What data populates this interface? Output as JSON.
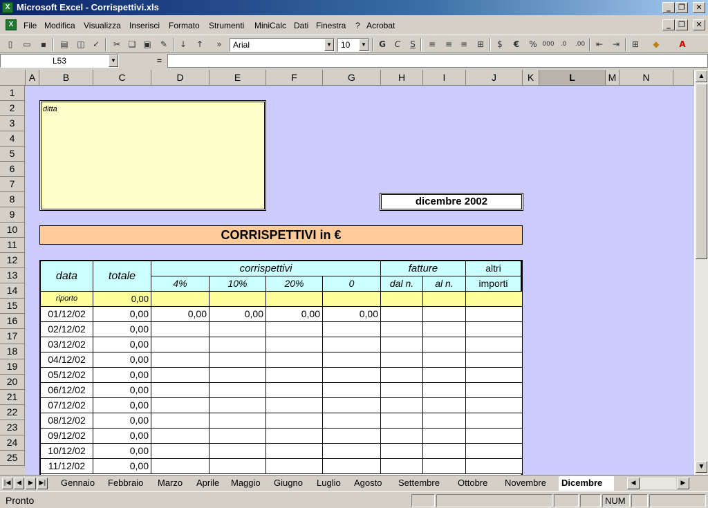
{
  "window": {
    "title": "Microsoft Excel - Corrispettivi.xls"
  },
  "menu": {
    "items": [
      "File",
      "Modifica",
      "Visualizza",
      "Inserisci",
      "Formato",
      "Strumenti",
      "MiniCalc",
      "Dati",
      "Finestra",
      "?",
      "Acrobat"
    ]
  },
  "toolbar": {
    "font": "Arial",
    "size": "10"
  },
  "formula_bar": {
    "name_box": "L53",
    "equals": "=",
    "content": ""
  },
  "columns": [
    "A",
    "B",
    "C",
    "D",
    "E",
    "F",
    "G",
    "H",
    "I",
    "J",
    "K",
    "L",
    "M",
    "N"
  ],
  "selected_column": "L",
  "rows": [
    "1",
    "2",
    "3",
    "4",
    "5",
    "6",
    "7",
    "8",
    "9",
    "10",
    "11",
    "12",
    "13",
    "14",
    "15",
    "16",
    "17",
    "18",
    "19",
    "20",
    "21",
    "22",
    "23",
    "24",
    "25"
  ],
  "sheet": {
    "company_label": "ditta",
    "period": "dicembre 2002",
    "heading": "CORRISPETTIVI in €",
    "table": {
      "h_data": "data",
      "h_totale": "totale",
      "h_corrispettivi": "corrispettivi",
      "h_fatture": "fatture",
      "h_altri": "altri",
      "h_importi": "importi",
      "rates": [
        "4%",
        "10%",
        "20%",
        "0"
      ],
      "h_dal": "dal n.",
      "h_al": "al n.",
      "riporto_label": "riporto",
      "riporto_value": "0,00",
      "rows": [
        {
          "data": "01/12/02",
          "totale": "0,00",
          "r4": "0,00",
          "r10": "0,00",
          "r20": "0,00",
          "r0": "0,00"
        },
        {
          "data": "02/12/02",
          "totale": "0,00"
        },
        {
          "data": "03/12/02",
          "totale": "0,00"
        },
        {
          "data": "04/12/02",
          "totale": "0,00"
        },
        {
          "data": "05/12/02",
          "totale": "0,00"
        },
        {
          "data": "06/12/02",
          "totale": "0,00"
        },
        {
          "data": "07/12/02",
          "totale": "0,00"
        },
        {
          "data": "08/12/02",
          "totale": "0,00"
        },
        {
          "data": "09/12/02",
          "totale": "0,00"
        },
        {
          "data": "10/12/02",
          "totale": "0,00"
        },
        {
          "data": "11/12/02",
          "totale": "0,00"
        }
      ]
    }
  },
  "tabs": [
    "Gennaio",
    "Febbraio",
    "Marzo",
    "Aprile",
    "Maggio",
    "Giugno",
    "Luglio",
    "Agosto",
    "Settembre",
    "Ottobre",
    "Novembre",
    "Dicembre"
  ],
  "active_tab": "Dicembre",
  "status": {
    "ready": "Pronto",
    "num": "NUM"
  },
  "colors": {
    "sheet_bg": "#ccccff",
    "company_box": "#ffffcc",
    "heading_bg": "#ffcc99",
    "header_cells": "#ccffff",
    "riporto_row": "#ffff99"
  }
}
